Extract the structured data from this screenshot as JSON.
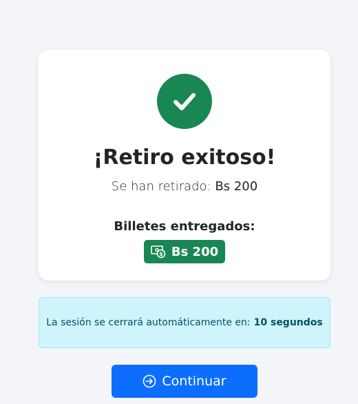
{
  "success": {
    "icon": "check-icon",
    "title": "¡Retiro exitoso!",
    "subtitle_prefix": "Se han retirado:",
    "amount": "Bs 200",
    "bills_heading": "Billetes entregados:",
    "bills": [
      {
        "icon": "cash-coin-icon",
        "label": "Bs 200"
      }
    ]
  },
  "session_alert": {
    "text": "La sesión se cerrará automáticamente en:",
    "countdown": "10 segundos"
  },
  "continue_button": {
    "icon": "arrow-right-circle-icon",
    "label": "Continuar"
  },
  "colors": {
    "success": "#198754",
    "info_bg": "#cff4fc",
    "info_text": "#055160",
    "primary": "#0d6efd",
    "page_bg": "#f4f5f8"
  }
}
